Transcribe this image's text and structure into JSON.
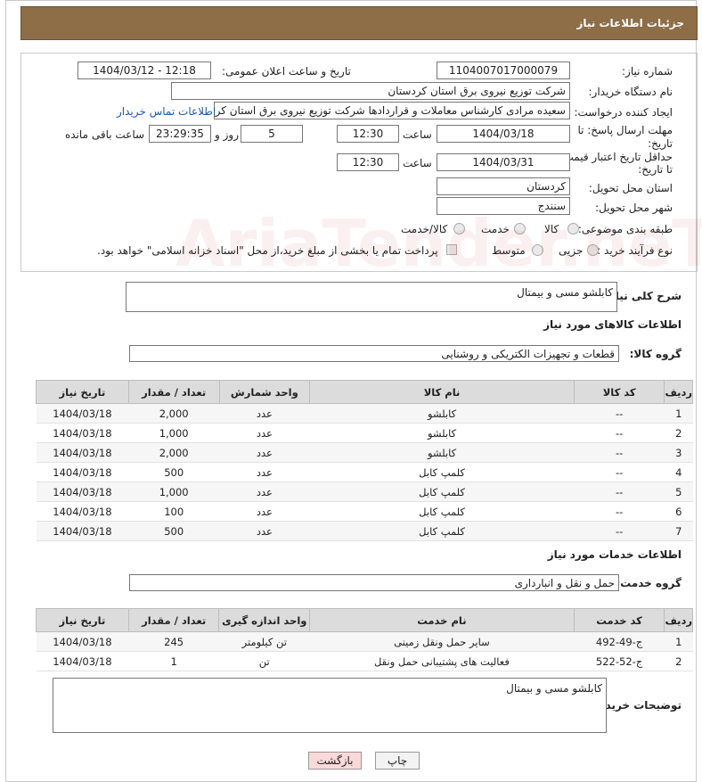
{
  "header": {
    "title": "جزئیات اطلاعات نیاز"
  },
  "form": {
    "need_number_label": "شماره نیاز:",
    "need_number": "1104007017000079",
    "announce_label": "تاریخ و ساعت اعلان عمومی:",
    "announce_value": "1404/03/12 - 12:18",
    "buyer_org_label": "نام دستگاه خریدار:",
    "buyer_org": "شرکت توزیع نیروی برق استان کردستان",
    "requester_label": "ایجاد کننده درخواست:",
    "requester": "سعیده مرادی کارشناس معاملات و قراردادها شرکت توزیع نیروی برق استان کردستان",
    "contact_link": "اطلاعات تماس خریدار",
    "deadline_label_1": "مهلت ارسال پاسخ: تا",
    "deadline_label_2": "تاریخ:",
    "deadline_date": "1404/03/18",
    "time_label": "ساعت",
    "deadline_time": "12:30",
    "days_value": "5",
    "days_label": "روز و",
    "remaining_value": "23:29:35",
    "remaining_label": "ساعت باقی مانده",
    "validity_label_1": "حداقل تاریخ اعتبار قیمت:",
    "validity_label_2": "تا تاریخ:",
    "validity_date": "1404/03/31",
    "validity_time": "12:30",
    "province_label": "استان محل تحویل:",
    "province": "کردستان",
    "city_label": "شهر محل تحویل:",
    "city": "سنندج",
    "category_label": "طبقه بندی موضوعی:",
    "category_options": [
      "کالا",
      "خدمت",
      "کالا/خدمت"
    ],
    "process_label": "نوع فرآیند خرید :",
    "process_options": [
      "جزیی",
      "متوسط"
    ],
    "payment_note": "پرداخت تمام یا بخشی از مبلغ خرید،از محل \"اسناد خزانه اسلامی\" خواهد بود."
  },
  "summary": {
    "label": "شرح کلی نیاز:",
    "text": "کابلشو مسی و بیمتال"
  },
  "goods": {
    "section_title": "اطلاعات کالاهای مورد نیاز",
    "group_label": "گروه کالا:",
    "group_value": "قطعات و تجهیزات الکتریکی و روشنایی",
    "columns": [
      "ردیف",
      "کد کالا",
      "نام کالا",
      "واحد شمارش",
      "تعداد / مقدار",
      "تاریخ نیاز"
    ],
    "rows": [
      [
        "1",
        "--",
        "کابلشو",
        "عدد",
        "2,000",
        "1404/03/18"
      ],
      [
        "2",
        "--",
        "کابلشو",
        "عدد",
        "1,000",
        "1404/03/18"
      ],
      [
        "3",
        "--",
        "کابلشو",
        "عدد",
        "2,000",
        "1404/03/18"
      ],
      [
        "4",
        "--",
        "کلمپ کابل",
        "عدد",
        "500",
        "1404/03/18"
      ],
      [
        "5",
        "--",
        "کلمپ کابل",
        "عدد",
        "1,000",
        "1404/03/18"
      ],
      [
        "6",
        "--",
        "کلمپ کابل",
        "عدد",
        "100",
        "1404/03/18"
      ],
      [
        "7",
        "--",
        "کلمپ کابل",
        "عدد",
        "500",
        "1404/03/18"
      ]
    ]
  },
  "services": {
    "section_title": "اطلاعات خدمات مورد نیاز",
    "group_label": "گروه خدمت:",
    "group_value": "حمل و نقل و انبارداری",
    "columns": [
      "ردیف",
      "کد خدمت",
      "نام خدمت",
      "واحد اندازه گیری",
      "تعداد / مقدار",
      "تاریخ نیاز"
    ],
    "rows": [
      [
        "1",
        "ج-49-492",
        "سایر حمل ونقل زمینی",
        "تن کیلومتر",
        "245",
        "1404/03/18"
      ],
      [
        "2",
        "ج-52-522",
        "فعالیت های پشتیبانی حمل ونقل",
        "تن",
        "1",
        "1404/03/18"
      ]
    ]
  },
  "buyer_notes": {
    "label": "توضیحات خریدار:",
    "text": "کابلشو مسی و بیمتال"
  },
  "buttons": {
    "print": "چاپ",
    "back": "بازگشت"
  },
  "watermark": "AriaTender.neT",
  "colors": {
    "header_bg": "#8d6e47",
    "link": "#1a55b8",
    "back_btn_bg": "#fbd9d9",
    "table_header": "#dcdcdc"
  }
}
